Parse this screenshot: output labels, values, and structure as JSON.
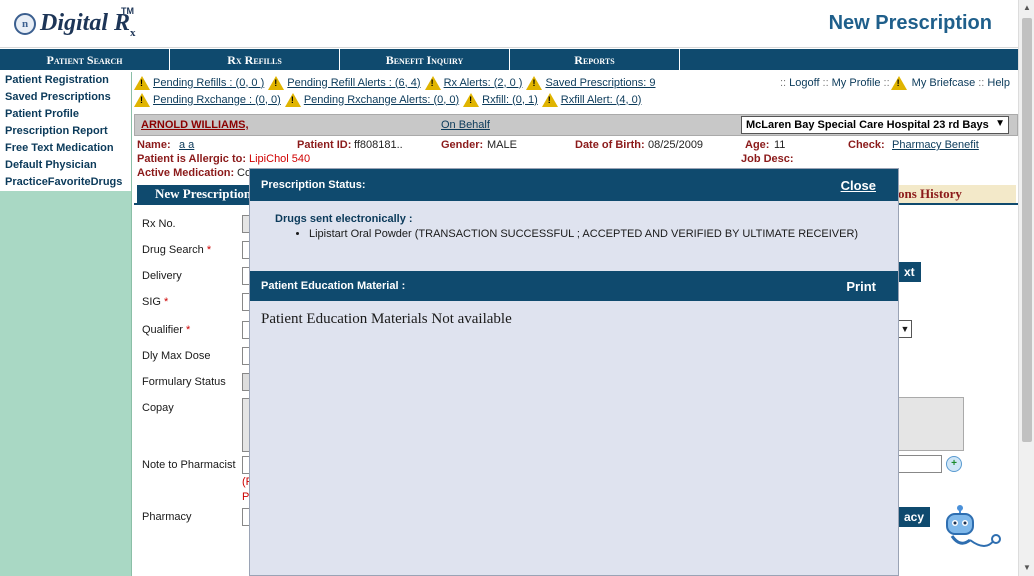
{
  "header": {
    "logo_text": "Digital R",
    "logo_sub": "x",
    "logo_tm": "TM",
    "logo_mark": "n",
    "title": "New Prescription"
  },
  "topnav": [
    "Patient Search",
    "Rx Refills",
    "Benefit Inquiry",
    "Reports"
  ],
  "sidebar": {
    "items": [
      "Patient Registration",
      "Saved Prescriptions",
      "Patient Profile",
      "Prescription Report",
      "Free Text Medication",
      "Default Physician",
      "PracticeFavoriteDrugs"
    ]
  },
  "alerts": {
    "row1": [
      "Pending Refills : (0, 0 )",
      "Pending Refill Alerts : (6, 4)",
      "Rx Alerts: (2, 0 )",
      "Saved Prescriptions: 9"
    ],
    "row2": [
      "Pending Rxchange : (0, 0)",
      "Pending Rxchange Alerts: (0, 0)",
      "Rxfill: (0, 1)",
      "Rxfill Alert: (4, 0)"
    ],
    "logoff": "Logoff",
    "my_profile": "My Profile",
    "my_briefcase": "My Briefcase",
    "help": "Help",
    "sep": "::"
  },
  "patient": {
    "name": "ARNOLD WILLIAMS,",
    "on_behalf": "On Behalf",
    "facility": "McLaren Bay Special Care Hospital 23 rd Bays",
    "name_label": "Name:",
    "name_value": "a a",
    "id_label": "Patient ID:",
    "id_value": "ff808181..",
    "gender_label": "Gender:",
    "gender_value": "MALE",
    "dob_label": "Date of Birth:",
    "dob_value": "08/25/2009",
    "age_label": "Age:",
    "age_value": "11",
    "check_label": "Check:",
    "check_value": "Pharmacy Benefit",
    "allergy_label": "Patient is Allergic to:",
    "allergy_value": "LipiChol 540",
    "active_med_label": "Active Medication:",
    "active_med_value": "Co",
    "job_label": "Job Desc:"
  },
  "form": {
    "tab_label": "New Prescription",
    "history_tab": "ons History",
    "labels": {
      "rx_no": "Rx No.",
      "drug_search": "Drug Search",
      "delivery": "Delivery",
      "sig": "SIG",
      "qualifier": "Qualifier",
      "dly_max": "Dly Max Dose",
      "formulary": "Formulary Status",
      "copay": "Copay",
      "note": "Note to Pharmacist",
      "pharmacy": "Pharmacy"
    },
    "required_mark": "*",
    "red_note_1": "(F",
    "red_note_2": "P",
    "next_btn": "xt",
    "pharmacy_btn": "acy"
  },
  "modal": {
    "status_title": "Prescription Status:",
    "close": "Close",
    "sent_label": "Drugs sent electronically :",
    "sent_items": [
      "Lipistart Oral Powder (TRANSACTION SUCCESSFUL ; ACCEPTED AND VERIFIED BY ULTIMATE RECEIVER)"
    ],
    "edu_title": "Patient Education Material :",
    "print": "Print",
    "edu_text": "Patient Education Materials Not available"
  },
  "icons": {
    "warning": "warning-icon",
    "logo": "digital-rx-logo",
    "robot": "robot-assistant-icon",
    "lookup": "lookup-icon"
  }
}
